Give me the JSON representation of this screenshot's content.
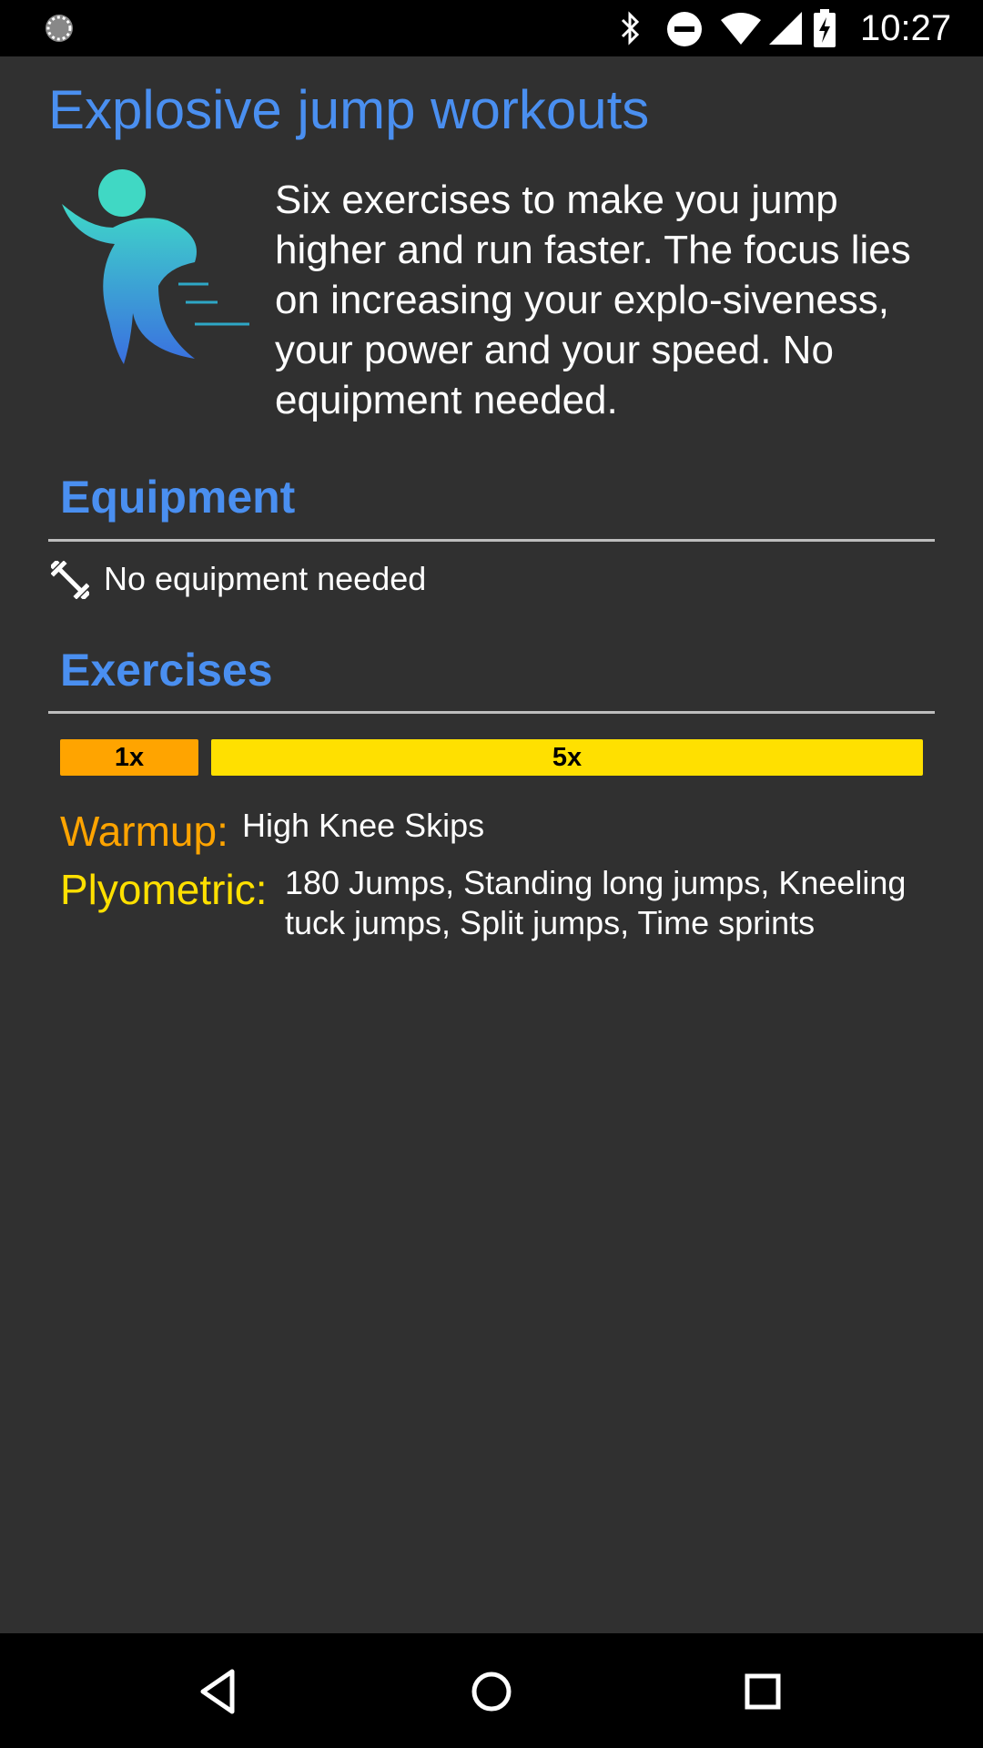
{
  "status_bar": {
    "time": "10:27",
    "icons": [
      "loading-icon",
      "bluetooth-icon",
      "do-not-disturb-icon",
      "wifi-icon",
      "signal-icon",
      "battery-charging-icon"
    ]
  },
  "workout": {
    "title": "Explosive jump workouts",
    "description": "Six exercises to make you jump higher and run faster. The focus lies on increasing your explo-siveness, your power and your speed. No equipment needed.",
    "icon": "running-figure-icon"
  },
  "equipment": {
    "heading": "Equipment",
    "item_icon": "dumbbell-icon",
    "item_text": "No equipment needed"
  },
  "exercises": {
    "heading": "Exercises",
    "rounds": [
      {
        "label": "1x",
        "color": "#ffa400",
        "fraction": 0.16
      },
      {
        "label": "5x",
        "color": "#ffe000",
        "fraction": 0.84
      }
    ],
    "groups": [
      {
        "label": "Warmup:",
        "color": "#ffa400",
        "items": "High Knee Skips"
      },
      {
        "label": "Plyometric:",
        "color": "#ffe000",
        "items": "180 Jumps, Standing long jumps, Kneeling tuck jumps, Split jumps, Time sprints"
      }
    ]
  },
  "nav_bar": {
    "buttons": [
      "back-icon",
      "home-icon",
      "recents-icon"
    ]
  },
  "colors": {
    "accent": "#4a8ff0",
    "background": "#303030",
    "warmup": "#ffa400",
    "plyometric": "#ffe000"
  }
}
